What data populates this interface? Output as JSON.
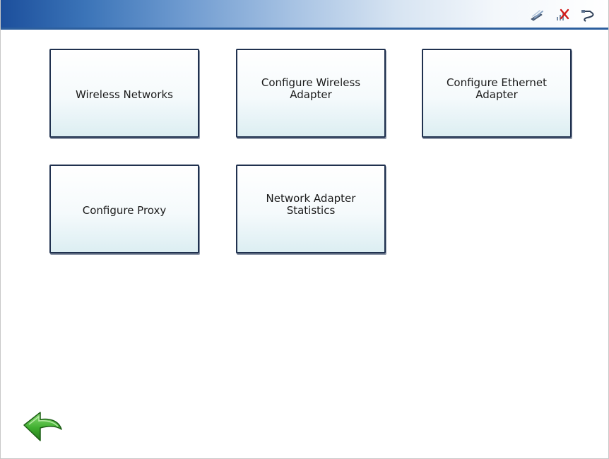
{
  "tiles": {
    "wireless_networks": "Wireless Networks",
    "configure_wireless_adapter": "Configure Wireless\nAdapter",
    "configure_ethernet_adapter": "Configure Ethernet\nAdapter",
    "configure_proxy": "Configure Proxy",
    "network_adapter_statistics": "Network Adapter\nStatistics"
  },
  "status_icons": [
    "wireless-signal-icon",
    "network-disconnected-icon",
    "ethernet-cable-icon"
  ],
  "back_icon": "back-arrow-icon",
  "colors": {
    "titlebar_dark": "#1c4f9c",
    "tile_border": "#20314f",
    "back_arrow": "#3fae2f"
  }
}
